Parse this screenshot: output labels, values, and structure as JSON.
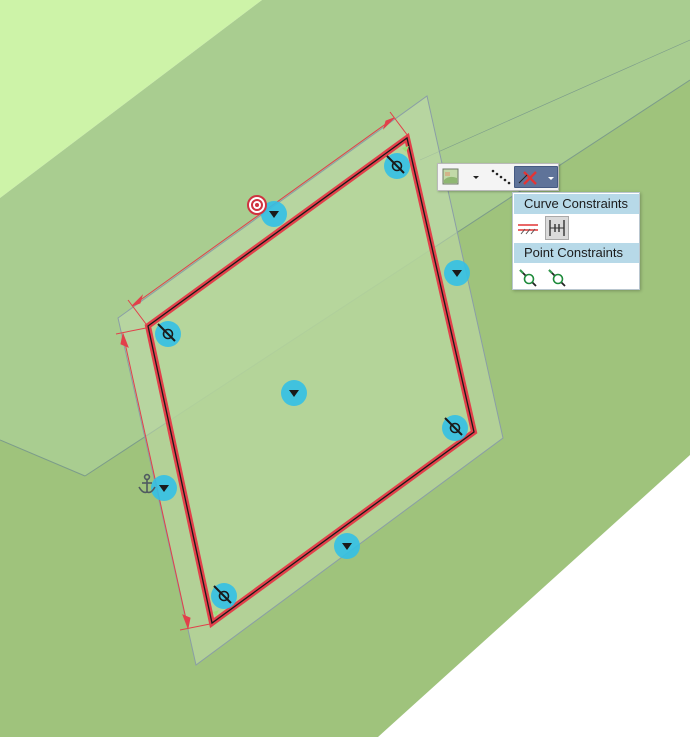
{
  "toolbar": {
    "tools": [
      {
        "name": "sketch-tool",
        "icon": "drawing-square-icon"
      },
      {
        "name": "dropdown",
        "icon": "chevron-down-icon"
      },
      {
        "name": "dotted-line-tool",
        "icon": "dotted-line-icon"
      },
      {
        "name": "delete-constraints",
        "icon": "red-x-icon",
        "selected": true
      }
    ]
  },
  "panel": {
    "curve_constraints_label": "Curve Constraints",
    "point_constraints_label": "Point Constraints",
    "curve_icons": [
      "parallel-lines-icon",
      "fixed-length-icon"
    ],
    "point_icons": [
      "point-constraint-icon",
      "point-constraint-alt-icon"
    ]
  },
  "colors": {
    "light_green": "#cdf3a8",
    "mid_green": "#a9cd90",
    "dark_green": "#9fc37c",
    "rect_fill": "#b4d49b",
    "outline_red": "#e2404a",
    "marker_blue": "#33c0e6",
    "panel_header": "#b7d9e8"
  }
}
